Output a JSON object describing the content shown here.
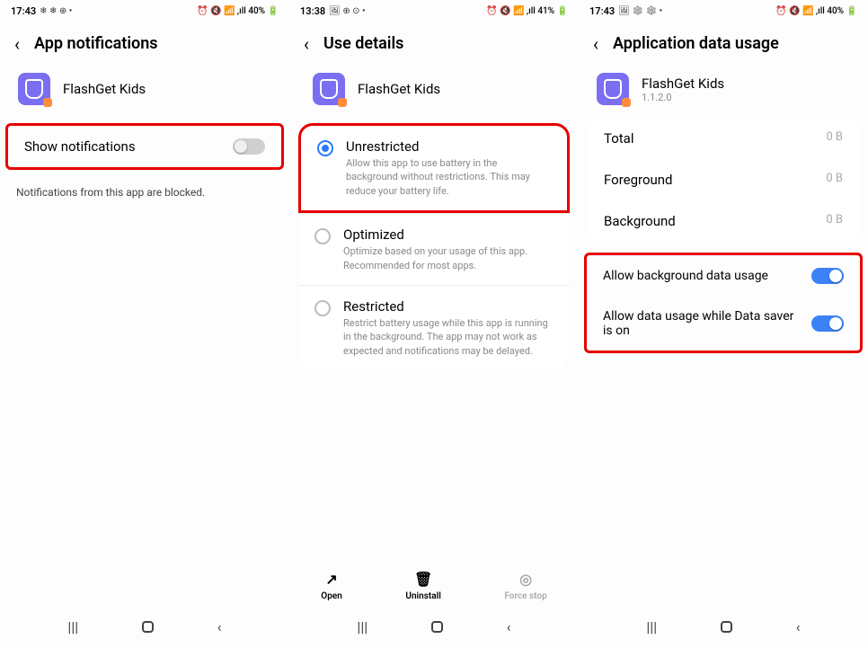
{
  "screens": [
    {
      "status": {
        "time": "17:43",
        "left_icons": "❄ ❄ ⊕ •",
        "right": "⏰ 🔇 📶 ,ıll 40% 🔋"
      },
      "title": "App notifications",
      "app": {
        "name": "FlashGet Kids"
      },
      "show_notifications_label": "Show notifications",
      "blocked_note": "Notifications from this app are blocked."
    },
    {
      "status": {
        "time": "13:38",
        "left_icons": "🖼 ⊕ ⊙ •",
        "right": "⏰ 🔇 📶 ,ıll 41% 🔋"
      },
      "title": "Use details",
      "app": {
        "name": "FlashGet Kids"
      },
      "options": [
        {
          "title": "Unrestricted",
          "desc": "Allow this app to use battery in the background without restrictions. This may reduce your battery life."
        },
        {
          "title": "Optimized",
          "desc": "Optimize based on your usage of this app. Recommended for most apps."
        },
        {
          "title": "Restricted",
          "desc": "Restrict battery usage while this app is running in the background. The app may not work as expected and notifications may be delayed."
        }
      ],
      "actions": {
        "open": "Open",
        "uninstall": "Uninstall",
        "force": "Force stop"
      }
    },
    {
      "status": {
        "time": "17:43",
        "left_icons": "🖼 ❄ ❄ •",
        "right": "⏰ 🔇 📶 ,ıll 40% 🔋"
      },
      "title": "Application data usage",
      "app": {
        "name": "FlashGet Kids",
        "version": "1.1.2.0"
      },
      "usage": [
        {
          "label": "Total",
          "value": "0 B"
        },
        {
          "label": "Foreground",
          "value": "0 B"
        },
        {
          "label": "Background",
          "value": "0 B"
        }
      ],
      "toggles": [
        {
          "label": "Allow background data usage"
        },
        {
          "label": "Allow data usage while Data saver is on"
        }
      ]
    }
  ]
}
